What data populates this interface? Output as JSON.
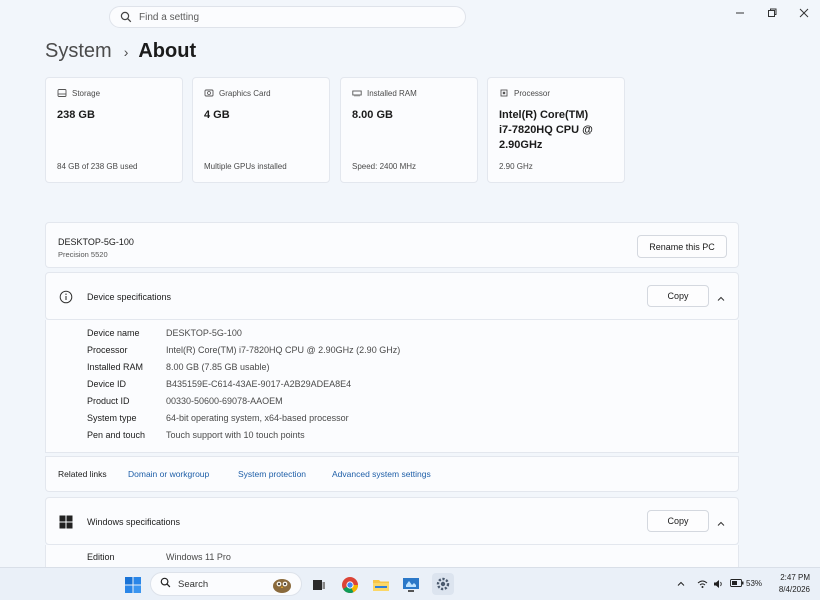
{
  "search": {
    "placeholder": "Find a setting"
  },
  "breadcrumb": {
    "parent": "System",
    "current": "About"
  },
  "cards": [
    {
      "title": "Storage",
      "value": "238 GB",
      "sub": "84 GB of 238 GB used",
      "icon": "storage-icon"
    },
    {
      "title": "Graphics Card",
      "value": "4 GB",
      "sub": "Multiple GPUs installed",
      "icon": "graphics-card-icon"
    },
    {
      "title": "Installed RAM",
      "value": "8.00 GB",
      "sub": "Speed: 2400 MHz",
      "icon": "ram-icon"
    },
    {
      "title": "Processor",
      "value_lines": [
        "Intel(R) Core(TM)",
        "i7-7820HQ CPU @",
        "2.90GHz"
      ],
      "sub": "2.90 GHz",
      "icon": "processor-icon"
    }
  ],
  "device": {
    "name": "DESKTOP-5G-100",
    "model": "Precision 5520",
    "rename_label": "Rename this PC"
  },
  "device_specs": {
    "title": "Device specifications",
    "copy_label": "Copy",
    "rows": [
      {
        "key": "Device name",
        "value": "DESKTOP-5G-100"
      },
      {
        "key": "Processor",
        "value": "Intel(R) Core(TM) i7-7820HQ CPU @ 2.90GHz (2.90 GHz)"
      },
      {
        "key": "Installed RAM",
        "value": "8.00 GB (7.85 GB usable)"
      },
      {
        "key": "Device ID",
        "value": "B435159E-C614-43AE-9017-A2B29ADEA8E4"
      },
      {
        "key": "Product ID",
        "value": "00330-50600-69078-AAOEM"
      },
      {
        "key": "System type",
        "value": "64-bit operating system, x64-based processor"
      },
      {
        "key": "Pen and touch",
        "value": "Touch support with 10 touch points"
      }
    ]
  },
  "related": {
    "label": "Related links",
    "links": [
      "Domain or workgroup",
      "System protection",
      "Advanced system settings"
    ]
  },
  "windows_specs": {
    "title": "Windows specifications",
    "copy_label": "Copy",
    "rows": [
      {
        "key": "Edition",
        "value": "Windows 11 Pro"
      }
    ]
  },
  "taskbar": {
    "search_placeholder": "Search",
    "battery": "53%",
    "time": "2:47 PM",
    "date": "8/4/2026"
  },
  "colors": {
    "accent": "#1f5fa8",
    "background": "#f2f6fb",
    "card": "#fbfcfe"
  }
}
